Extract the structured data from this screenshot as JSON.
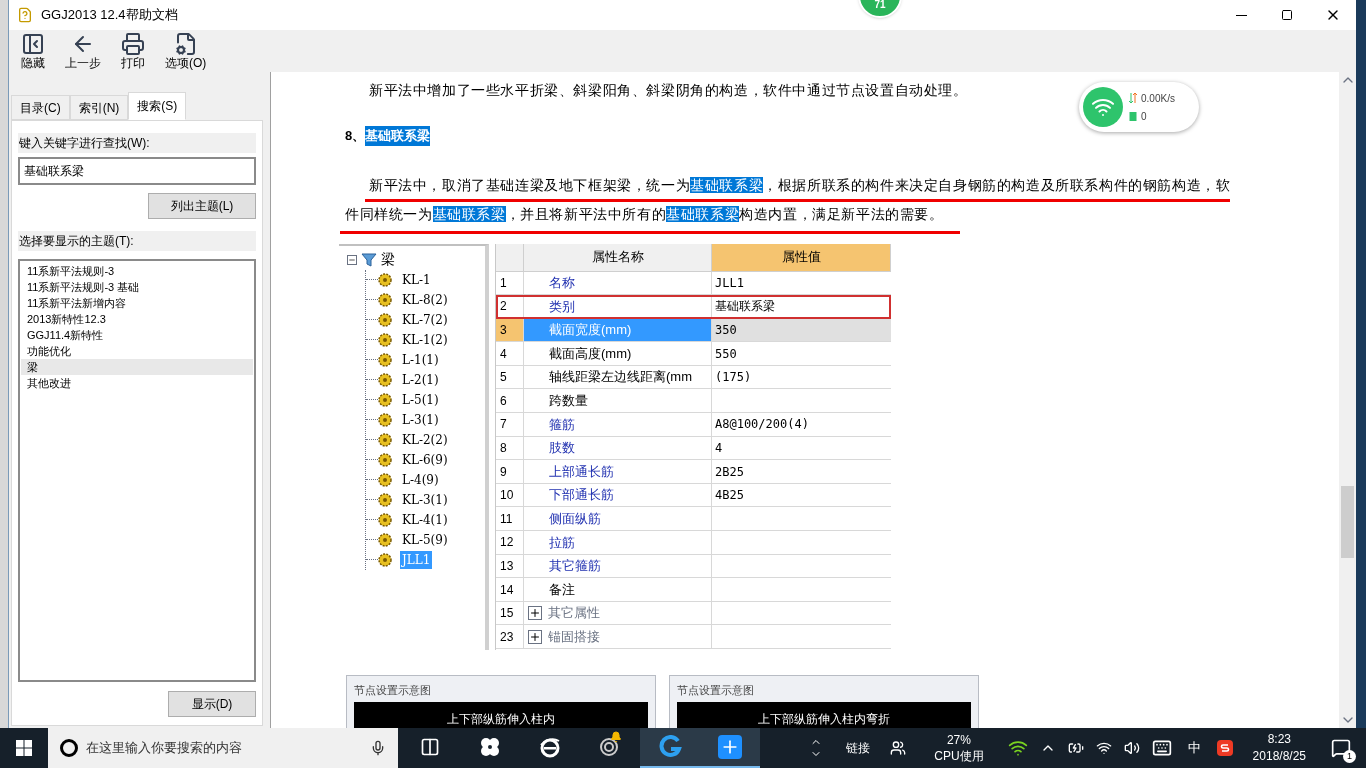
{
  "window": {
    "title": "GGJ2013 12.4帮助文档"
  },
  "floating_badge": {
    "text": "71"
  },
  "toolbar": [
    {
      "label": "隐藏",
      "kind": "hide"
    },
    {
      "label": "上一步",
      "kind": "back"
    },
    {
      "label": "打印",
      "kind": "print"
    },
    {
      "label": "选项(O)",
      "kind": "options"
    }
  ],
  "nav": {
    "tabs": [
      {
        "label": "目录(C)",
        "selected": false
      },
      {
        "label": "索引(N)",
        "selected": false
      },
      {
        "label": "搜索(S)",
        "selected": true
      }
    ],
    "search_label": "键入关键字进行查找(W):",
    "search_value": "基础联系梁",
    "list_button": "列出主题(L)",
    "topics_label": "选择要显示的主题(T):",
    "topics": [
      {
        "label": "11系新平法规则-3",
        "selected": false
      },
      {
        "label": "11系新平法规则-3 基础",
        "selected": false
      },
      {
        "label": "11系新平法新增内容",
        "selected": false
      },
      {
        "label": "2013新特性12.3",
        "selected": false
      },
      {
        "label": "GGJ11.4新特性",
        "selected": false
      },
      {
        "label": "功能优化",
        "selected": false
      },
      {
        "label": "梁",
        "selected": true
      },
      {
        "label": "其他改进",
        "selected": false
      }
    ],
    "display_button": "显示(D)"
  },
  "document": {
    "intro": "新平法中增加了一些水平折梁、斜梁阳角、斜梁阴角的构造，软件中通过节点设置自动处理。",
    "heading": {
      "number": "8、",
      "title": "基础联系梁",
      "highlighted": true
    },
    "paragraph": [
      {
        "text": "新平法中，取消了基础连梁及地下框架梁，统一为",
        "highlighted": false
      },
      {
        "text": "基础联系梁",
        "highlighted": true
      },
      {
        "text": "，根据所联系的构件来决定自身钢筋的构造及所联系构件的钢筋构造，软件同样统一为",
        "highlighted": false
      },
      {
        "text": "基础联系梁",
        "highlighted": true
      },
      {
        "text": "，并且将新平法中所有的",
        "highlighted": false
      },
      {
        "text": "基础联系梁",
        "highlighted": true
      },
      {
        "text": "构造内置，满足新平法的需要。",
        "highlighted": false
      }
    ],
    "figure": {
      "tree": {
        "label": "梁",
        "expanded": true,
        "children": [
          {
            "label": "KL-1",
            "selected": false
          },
          {
            "label": "KL-8(2)",
            "selected": false
          },
          {
            "label": "KL-7(2)",
            "selected": false
          },
          {
            "label": "KL-1(2)",
            "selected": false
          },
          {
            "label": "L-1(1)",
            "selected": false
          },
          {
            "label": "L-2(1)",
            "selected": false
          },
          {
            "label": "L-5(1)",
            "selected": false
          },
          {
            "label": "L-3(1)",
            "selected": false
          },
          {
            "label": "KL-2(2)",
            "selected": false
          },
          {
            "label": "KL-6(9)",
            "selected": false
          },
          {
            "label": "L-4(9)",
            "selected": false
          },
          {
            "label": "KL-3(1)",
            "selected": false
          },
          {
            "label": "KL-4(1)",
            "selected": false
          },
          {
            "label": "KL-5(9)",
            "selected": false
          },
          {
            "label": "JLL1",
            "selected": true
          }
        ]
      },
      "grid": {
        "columns": [
          {
            "label": "属性名称",
            "active": false
          },
          {
            "label": "属性值",
            "active": true
          }
        ],
        "rows": [
          {
            "index": "1",
            "name": "名称",
            "value": "JLL1",
            "kind": "linked",
            "selected": false,
            "marked": false
          },
          {
            "index": "2",
            "name": "类别",
            "value": "基础联系梁",
            "kind": "linked",
            "selected": false,
            "marked": true
          },
          {
            "index": "3",
            "name": "截面宽度(mm)",
            "value": "350",
            "kind": "linked",
            "selected": true,
            "marked": false
          },
          {
            "index": "4",
            "name": "截面高度(mm)",
            "value": "550",
            "kind": "plain",
            "selected": false,
            "marked": false
          },
          {
            "index": "5",
            "name": "轴线距梁左边线距离(mm",
            "value": "(175)",
            "kind": "plain",
            "selected": false,
            "marked": false
          },
          {
            "index": "6",
            "name": "跨数量",
            "kind": "plain",
            "selected": false,
            "marked": false
          },
          {
            "index": "7",
            "name": "箍筋",
            "value": "A8@100/200(4)",
            "kind": "linked",
            "selected": false,
            "marked": false
          },
          {
            "index": "8",
            "name": "肢数",
            "value": "4",
            "kind": "linked",
            "selected": false,
            "marked": false
          },
          {
            "index": "9",
            "name": "上部通长筋",
            "value": "2B25",
            "kind": "linked",
            "selected": false,
            "marked": false
          },
          {
            "index": "10",
            "name": "下部通长筋",
            "value": "4B25",
            "kind": "linked",
            "selected": false,
            "marked": false
          },
          {
            "index": "11",
            "name": "侧面纵筋",
            "kind": "linked",
            "selected": false,
            "marked": false
          },
          {
            "index": "12",
            "name": "拉筋",
            "kind": "linked",
            "selected": false,
            "marked": false
          },
          {
            "index": "13",
            "name": "其它箍筋",
            "kind": "linked",
            "selected": false,
            "marked": false
          },
          {
            "index": "14",
            "name": "备注",
            "kind": "plain",
            "selected": false,
            "marked": false
          },
          {
            "index": "15",
            "name": "其它属性",
            "kind": "group",
            "selected": false,
            "marked": false
          },
          {
            "index": "23",
            "name": "锚固搭接",
            "kind": "group",
            "selected": false,
            "marked": false
          }
        ]
      }
    },
    "diagrams": [
      {
        "title": "节点设置示意图",
        "caption": "上下部纵筋伸入柱内"
      },
      {
        "title": "节点设置示意图",
        "caption": "上下部纵筋伸入柱内弯折"
      }
    ]
  },
  "network_widget": {
    "speed": "0.00K/s",
    "count": "0"
  },
  "taskbar": {
    "search_placeholder": "在这里输入你要搜索的内容",
    "apps": [
      {
        "kind": "taskview",
        "open": false
      },
      {
        "kind": "fan",
        "open": false
      },
      {
        "kind": "browser",
        "open": false
      },
      {
        "kind": "notify",
        "open": false
      },
      {
        "kind": "glodon",
        "open": true
      },
      {
        "kind": "plus",
        "open": true
      }
    ],
    "links_label": "链接",
    "cpu_percent": "27%",
    "cpu_label": "CPU使用",
    "ime": "中",
    "time": "8:23",
    "date": "2018/8/25",
    "notifications": "1"
  }
}
